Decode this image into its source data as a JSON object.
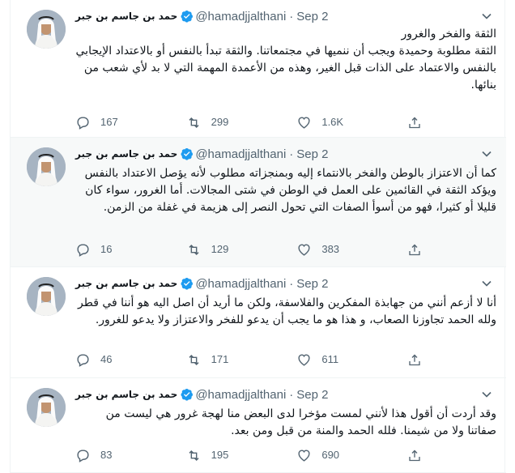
{
  "icons": {
    "verified": "verified-badge-icon",
    "more": "chevron-down-icon",
    "reply": "reply-icon",
    "retweet": "retweet-icon",
    "like": "heart-icon",
    "share": "share-icon"
  },
  "colors": {
    "verified": "#1d9bf0",
    "secondary_text": "#536471",
    "highlight_bg": "#f7f9f9"
  },
  "tweets": [
    {
      "author_name": "حمد بن جاسم بن جبر",
      "handle": "@hamadjjalthani",
      "separator": "·",
      "date": "Sep 2",
      "text": "الثقة والفخر والغرور\nالثقة مطلوبة وحميدة ويجب أن ننميها في مجتمعاتنا. والثقة تبدأ بالنفس أو بالاعتداد الإيجابي بالنفس والاعتماد على الذات قبل الغير، وهذه من الأعمدة المهمة التي لا بد لأي شعب من بنائها.",
      "replies": "167",
      "retweets": "299",
      "likes": "1.6K"
    },
    {
      "author_name": "حمد بن جاسم بن جبر",
      "handle": "@hamadjjalthani",
      "separator": "·",
      "date": "Sep 2",
      "text": "كما أن الاعتزاز بالوطن والفخر بالانتماء إليه وبمنجزاته مطلوب لأنه يؤصل الاعتداد بالنفس ويؤكد الثقة في القائمين على العمل في الوطن في شتى المجالات. أما الغرور، سواء كان قليلا أو كثيرا، فهو من أسوأ الصفات التي تحول النصر إلى هزيمة في غفلة من الزمن.",
      "replies": "16",
      "retweets": "129",
      "likes": "383"
    },
    {
      "author_name": "حمد بن جاسم بن جبر",
      "handle": "@hamadjjalthani",
      "separator": "·",
      "date": "Sep 2",
      "text": "أنا لا أزعم أنني من جهابذة المفكرين والفلاسفة، ولكن ما أريد أن اصل اليه هو أننا في قطر ولله الحمد تجاوزنا الصعاب، و هذا هو ما يجب أن يدعو للفخر والاعتزاز ولا يدعو للغرور.",
      "replies": "46",
      "retweets": "171",
      "likes": "611"
    },
    {
      "author_name": "حمد بن جاسم بن جبر",
      "handle": "@hamadjjalthani",
      "separator": "·",
      "date": "Sep 2",
      "text": "وقد أردت أن أقول هذا لأنني لمست مؤخرا لدى البعض منا لهجة غرور هي ليست من صفاتنا ولا من شيمنا.  فلله الحمد والمنة من قبل ومن بعد.",
      "replies": "83",
      "retweets": "195",
      "likes": "690"
    }
  ]
}
